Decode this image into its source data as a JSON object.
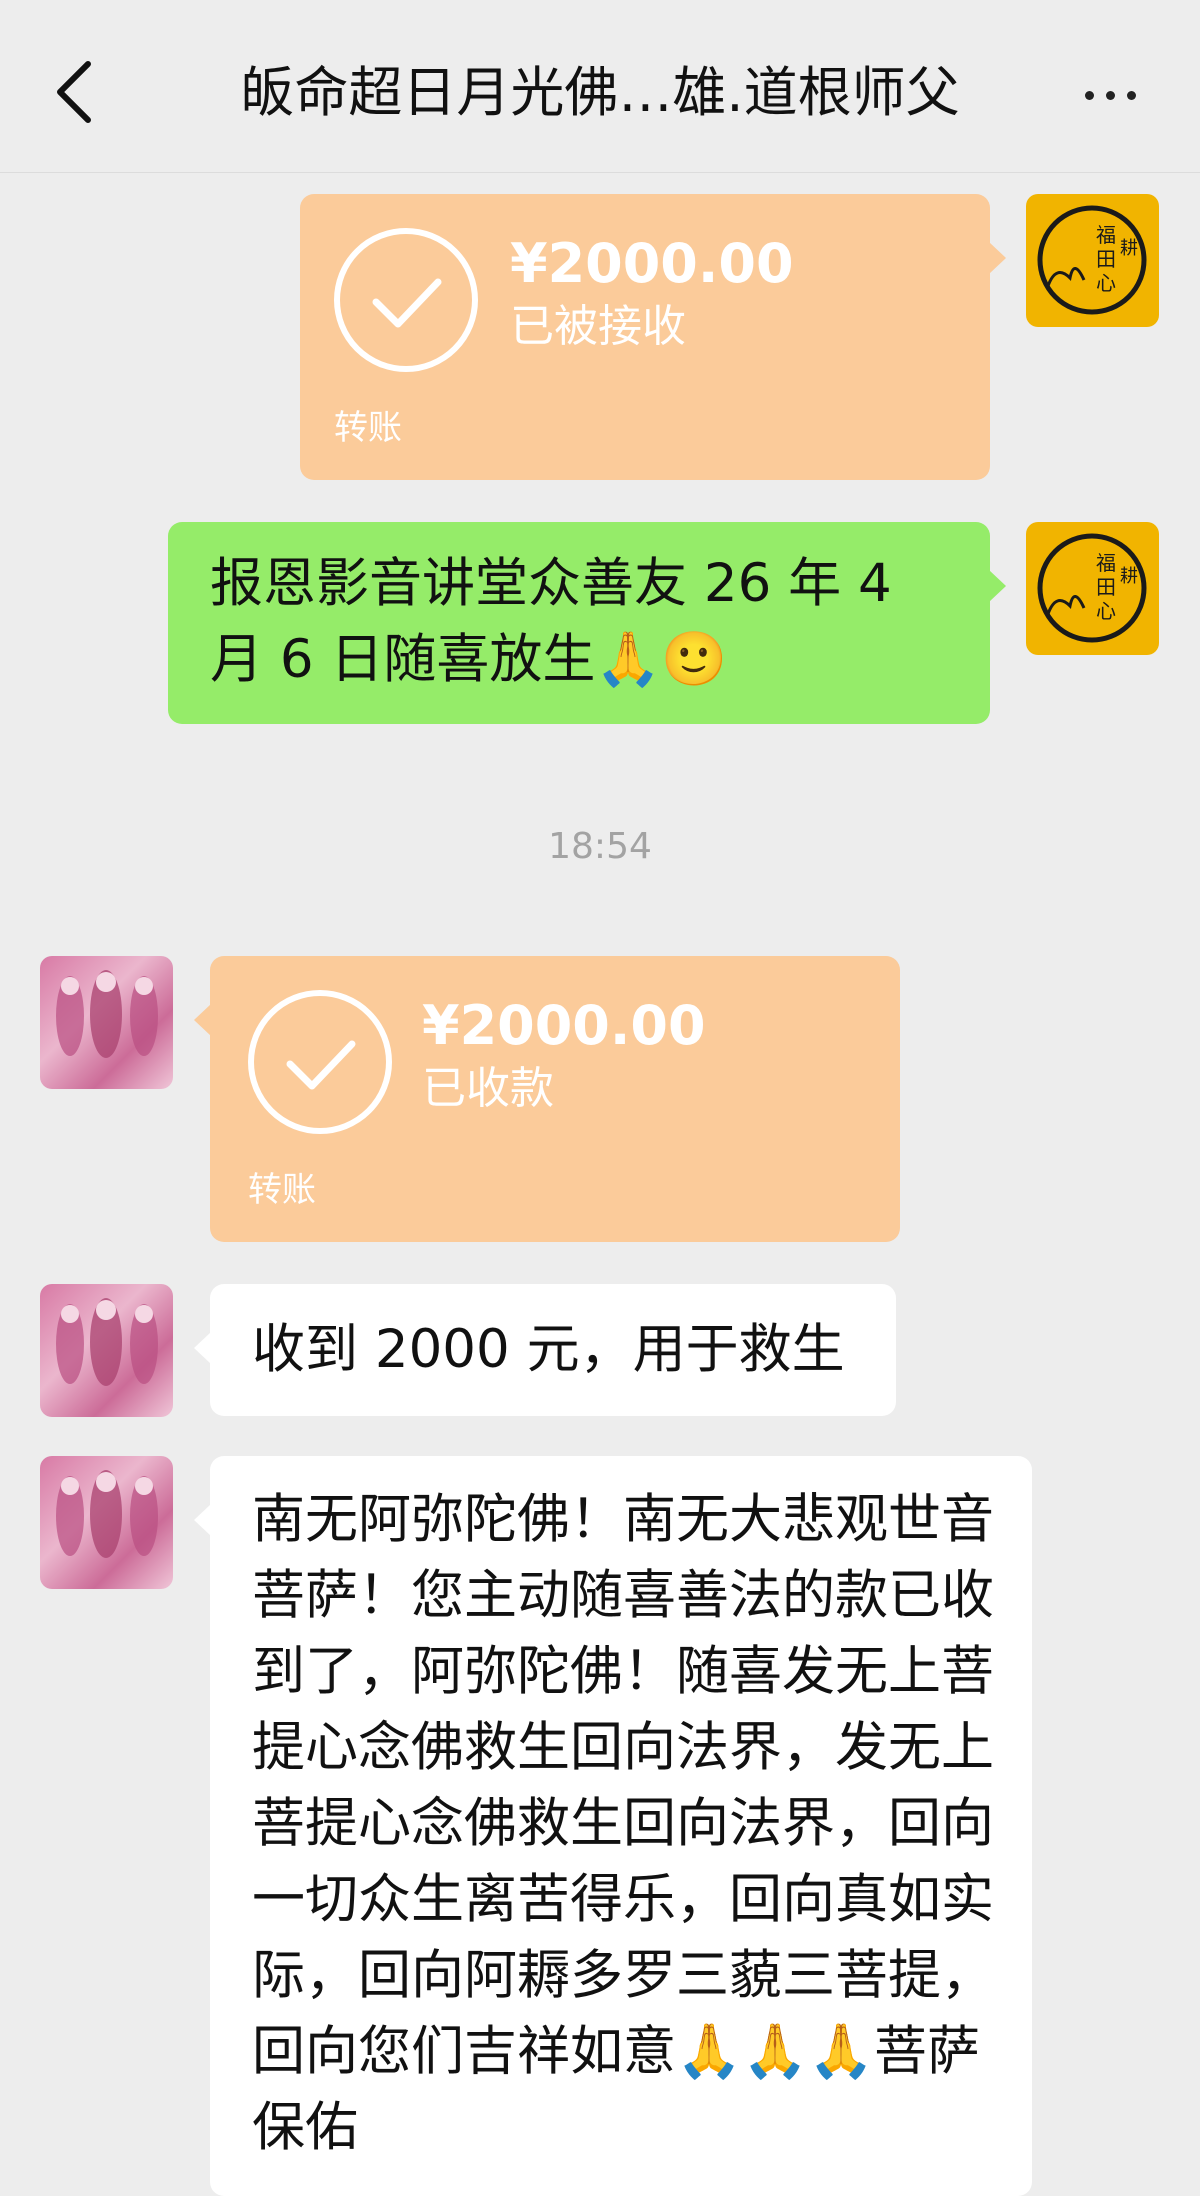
{
  "header": {
    "title": "皈命超日月光佛…雄.道根师父",
    "back_icon": "chevron-left-icon",
    "more_icon": "more-dots-icon"
  },
  "messages": {
    "m1": {
      "sender": "self",
      "type": "transfer",
      "amount": "¥2000.00",
      "status": "已被接收",
      "kind": "转账"
    },
    "m2": {
      "sender": "self",
      "type": "text",
      "text": "报恩影音讲堂众善友 26 年 4 月 6 日随喜放生🙏🙂"
    },
    "timestamp": "18:54",
    "m3": {
      "sender": "other",
      "type": "transfer",
      "amount": "¥2000.00",
      "status": "已收款",
      "kind": "转账"
    },
    "m4": {
      "sender": "other",
      "type": "text",
      "text": "收到 2000 元，用于救生"
    },
    "m5": {
      "sender": "other",
      "type": "text",
      "text": "南无阿弥陀佛！南无大悲观世音菩萨！您主动随喜善法的款已收到了，阿弥陀佛！随喜发无上菩提心念佛救生回向法界，发无上菩提心念佛救生回向法界，回向一切众生离苦得乐，回向真如实际，回向阿耨多罗三藐三菩提，回向您们吉祥如意🙏🙏🙏菩萨保佑"
    }
  },
  "avatars": {
    "self_text": "福田心耕",
    "self_color": "#f1b400",
    "other_color": "#d87aa5"
  },
  "colors": {
    "transfer_bubble": "#fbcb9a",
    "self_bubble": "#95ec69",
    "other_bubble": "#ffffff",
    "background": "#ededed"
  }
}
